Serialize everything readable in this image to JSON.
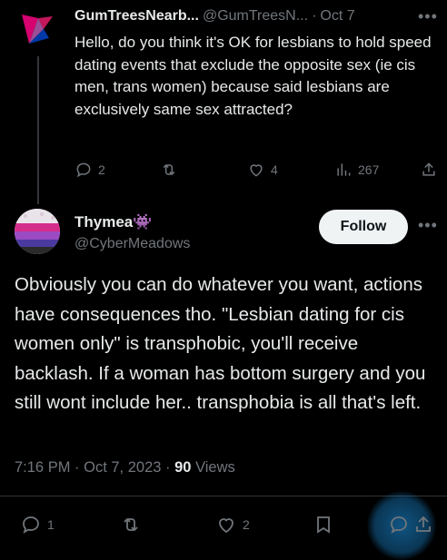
{
  "tweet1": {
    "name": "GumTreesNearb...",
    "handle": "@GumTreesN...",
    "date": "Oct 7",
    "text": "Hello, do you think it's OK for lesbians to hold speed dating events that exclude the opposite sex (ie cis men, trans women) because said lesbians are exclusively same sex attracted?",
    "replies": "2",
    "likes": "4",
    "views": "267"
  },
  "tweet2": {
    "name": "Thymea👾",
    "handle": "@CyberMeadows",
    "follow_label": "Follow",
    "text": "Obviously you can do whatever you want, actions have consequences tho. \"Lesbian dating for cis women only\" is transphobic, you'll receive backlash. If a woman has bottom surgery and you still wont include her.. transphobia is all that's left.",
    "time": "7:16 PM",
    "date": "Oct 7, 2023",
    "views_count": "90",
    "views_label": "Views",
    "replies": "1",
    "likes": "2"
  },
  "colors": {
    "background": "#000000",
    "text": "#e7e9ea",
    "muted": "#71767b",
    "accent": "#1d9bf0"
  },
  "icons": [
    "reply-icon",
    "retweet-icon",
    "like-icon",
    "views-icon",
    "share-icon",
    "bookmark-icon",
    "more-icon"
  ]
}
